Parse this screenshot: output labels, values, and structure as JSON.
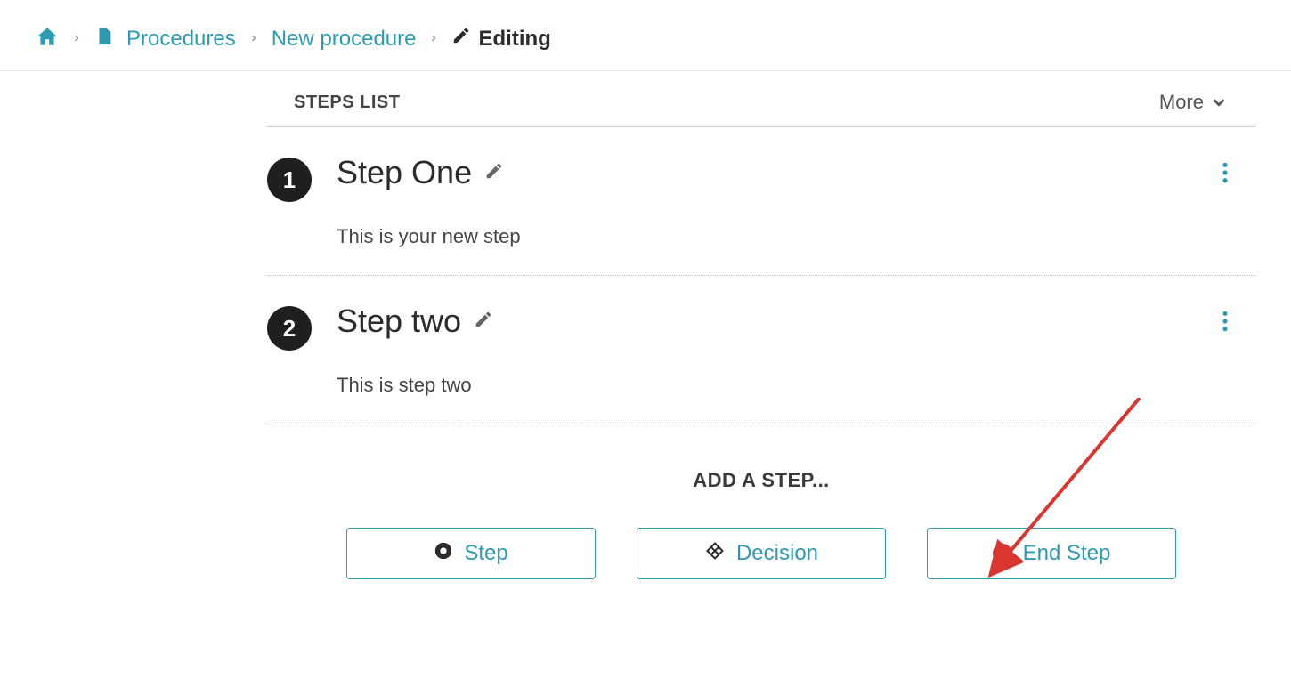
{
  "breadcrumb": {
    "procedures": "Procedures",
    "new_procedure": "New procedure",
    "editing": "Editing"
  },
  "list_header": {
    "title": "STEPS LIST",
    "more": "More"
  },
  "steps": [
    {
      "num": "1",
      "title": "Step One",
      "desc": "This is your new step"
    },
    {
      "num": "2",
      "title": "Step two",
      "desc": "This is step two"
    }
  ],
  "add": {
    "title": "ADD A STEP...",
    "step": "Step",
    "decision": "Decision",
    "end_step": "End Step"
  }
}
